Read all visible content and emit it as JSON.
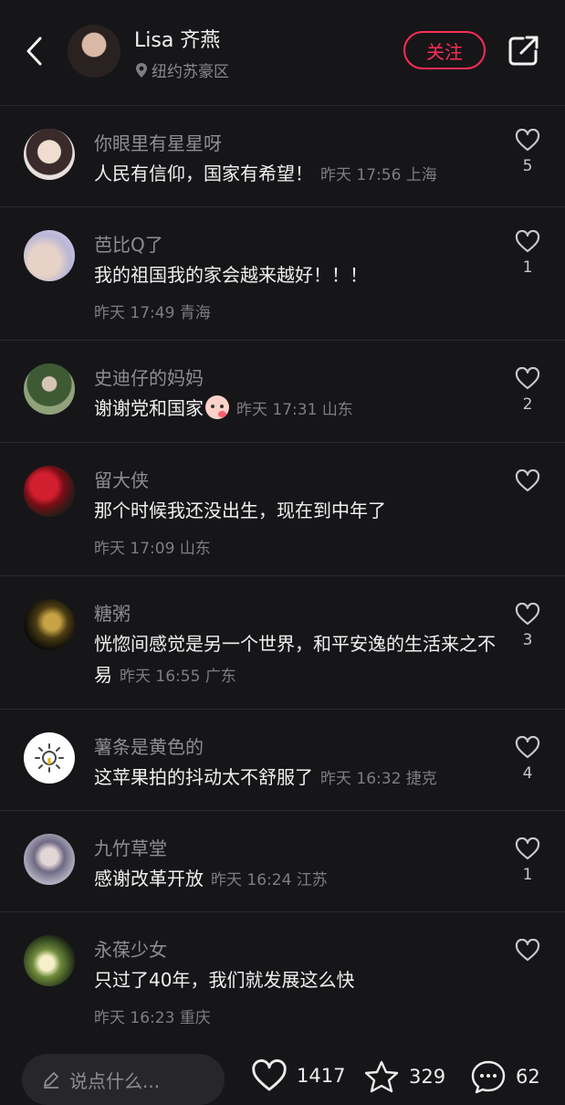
{
  "header": {
    "author_name": "Lisa 齐燕",
    "author_location": "纽约苏豪区",
    "follow_label": "关注"
  },
  "comments": [
    {
      "name": "你眼里有星星呀",
      "text": "人民有信仰，国家有希望！",
      "time": "昨天 17:56",
      "region": "上海",
      "likes": "5"
    },
    {
      "name": "芭比Q了",
      "text": "我的祖国我的家会越来越好！！！",
      "time": "昨天 17:49",
      "region": "青海",
      "likes": "1"
    },
    {
      "name": "史迪仔的妈妈",
      "text": "谢谢党和国家",
      "time": "昨天 17:31",
      "region": "山东",
      "likes": "2"
    },
    {
      "name": "留大侠",
      "text": "那个时候我还没出生，现在到中年了",
      "time": "昨天 17:09",
      "region": "山东",
      "likes": ""
    },
    {
      "name": "糖粥",
      "text": "恍惚间感觉是另一个世界，和平安逸的生活来之不易",
      "time": "昨天 16:55",
      "region": "广东",
      "likes": "3"
    },
    {
      "name": "薯条是黄色的",
      "text": "这苹果拍的抖动太不舒服了",
      "time": "昨天 16:32",
      "region": "捷克",
      "likes": "4"
    },
    {
      "name": "九竹草堂",
      "text": "感谢改革开放",
      "time": "昨天 16:24",
      "region": "江苏",
      "likes": "1"
    },
    {
      "name": "永葆少女",
      "text": "只过了40年，我们就发展这么快",
      "time": "昨天 16:23",
      "region": "重庆",
      "likes": ""
    }
  ],
  "bottom_bar": {
    "input_placeholder": "说点什么...",
    "likes": "1417",
    "favorites": "329",
    "comments": "62"
  },
  "colors": {
    "background": "#161619",
    "accent": "#ff2d55",
    "secondary_text": "#8d8d92"
  }
}
